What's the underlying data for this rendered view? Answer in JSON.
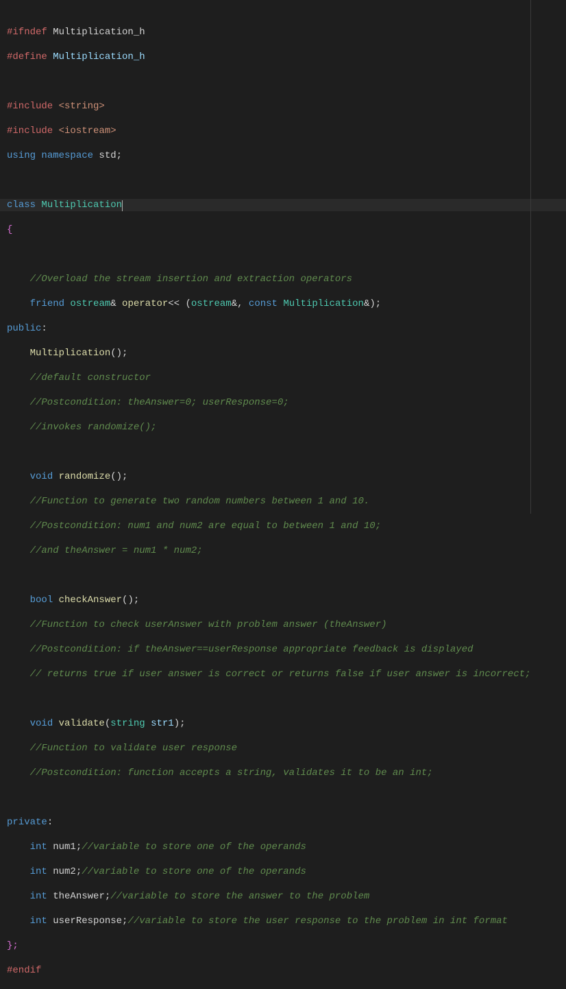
{
  "code": {
    "l1": {
      "a": "#ifndef",
      "b": " Multiplication_h"
    },
    "l2": {
      "a": "#define",
      "b": " Multiplication_h"
    },
    "l3": "",
    "l4": {
      "a": "#include",
      "b": " <string>"
    },
    "l5": {
      "a": "#include",
      "b": " <iostream>"
    },
    "l6": {
      "a": "using",
      "b": " namespace",
      "c": " std",
      "d": ";"
    },
    "l7": "",
    "l8": {
      "a": "class",
      "b": " Multiplication"
    },
    "l9": "{",
    "l10": "",
    "l11": "    //Overload the stream insertion and extraction operators",
    "l12": {
      "a": "    ",
      "b": "friend",
      "c": " ostream",
      "d": "&",
      "e": " operator",
      "f": "<< (",
      "g": "ostream",
      "h": "&, ",
      "i": "const",
      "j": " Multiplication",
      "k": "&);"
    },
    "l13": {
      "a": "public",
      "b": ":"
    },
    "l14": {
      "a": "    ",
      "b": "Multiplication",
      "c": "();"
    },
    "l15": "    //default constructor",
    "l16": "    //Postcondition: theAnswer=0; userResponse=0;",
    "l17": "    //invokes randomize();",
    "l18": "",
    "l19": {
      "a": "    ",
      "b": "void",
      "c": " randomize",
      "d": "();"
    },
    "l20": "    //Function to generate two random numbers between 1 and 10.",
    "l21": "    //Postcondition: num1 and num2 are equal to between 1 and 10;",
    "l22": "    //and theAnswer = num1 * num2;",
    "l23": "",
    "l24": {
      "a": "    ",
      "b": "bool",
      "c": " checkAnswer",
      "d": "();"
    },
    "l25": "    //Function to check userAnswer with problem answer (theAnswer)",
    "l26": "    //Postcondition: if theAnswer==userResponse appropriate feedback is displayed",
    "l27": "    // returns true if user answer is correct or returns false if user answer is incorrect;",
    "l28": "",
    "l29": {
      "a": "    ",
      "b": "void",
      "c": " validate",
      "d": "(",
      "e": "string",
      "f": " str1",
      "g": ");"
    },
    "l30": "    //Function to validate user response",
    "l31": "    //Postcondition: function accepts a string, validates it to be an int;",
    "l32": "",
    "l33": {
      "a": "private",
      "b": ":"
    },
    "l34": {
      "a": "    ",
      "b": "int",
      "c": " num1;",
      "d": "//variable to store one of the operands"
    },
    "l35": {
      "a": "    ",
      "b": "int",
      "c": " num2;",
      "d": "//variable to store one of the operands"
    },
    "l36": {
      "a": "    ",
      "b": "int",
      "c": " theAnswer;",
      "d": "//variable to store the answer to the problem"
    },
    "l37": {
      "a": "    ",
      "b": "int",
      "c": " userResponse;",
      "d": "//variable to store the user response to the problem in int format"
    },
    "l38": "};",
    "l39": "#endif"
  }
}
